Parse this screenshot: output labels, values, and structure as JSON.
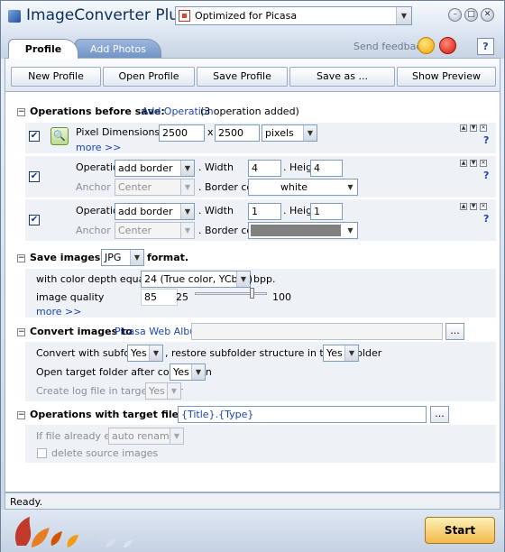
{
  "title": {
    "app": "ImageConverter Plus",
    "profile": "Optimized  for Picasa",
    "win_buttons": [
      "–",
      "□",
      "✕"
    ]
  },
  "tabs": [
    {
      "label": "Profile"
    },
    {
      "label": "Add Photos"
    }
  ],
  "feedback": {
    "label": "Send feedback:",
    "help": "?"
  },
  "toolbar": {
    "new": "New Profile",
    "open": "Open Profile",
    "save": "Save Profile",
    "save_as": "Save as ...",
    "preview": "Show Preview"
  },
  "ops": {
    "title": "Operations before save:",
    "add_link": "Add Operation",
    "count": "(3 operation added)",
    "pixel": {
      "label": "Pixel Dimensions :",
      "width": "2500",
      "x": "x",
      "height": "2500",
      "unit": "pixels",
      "more": "more >>"
    },
    "border1": {
      "op_label": "Operation",
      "op_value": "add border",
      "width_label": ". Width",
      "width": "4",
      "height_label": ". Height",
      "height": "4",
      "anchor_label": "Anchor",
      "anchor": "Center",
      "color_label": ". Border color",
      "color": "white"
    },
    "border2": {
      "op_label": "Operation",
      "op_value": "add border",
      "width_label": ". Width",
      "width": "1",
      "height_label": ". Height",
      "height": "1",
      "anchor_label": "Anchor",
      "anchor": "Center",
      "color_label": ". Border color",
      "color_hex": "#808080"
    },
    "help": "?"
  },
  "save": {
    "title_pre": "Save images in",
    "format": "JPG",
    "title_post": "format.",
    "depth_label": "with color depth equal to",
    "depth": "24 (True color, YCbCr)",
    "bpp": "bpp.",
    "quality_label": "image quality",
    "quality": "85",
    "q_min": "25",
    "q_max": "100",
    "quality_level": 0.8,
    "more": "more >>"
  },
  "convert": {
    "title": "Convert images to",
    "target": "Picasa Web Album",
    "subfolders_label": "Convert with subfolders",
    "subfolders": "Yes",
    "restore_label": ", restore subfolder structure in target folder",
    "restore": "Yes",
    "open_label": "Open target folder after conversion",
    "open": "Yes",
    "log_label": "Create log file in target folder",
    "log": "Yes",
    "browse": "..."
  },
  "naming": {
    "title": "Operations with target file name",
    "pattern": "{Title}.{Type}",
    "exists_label": "If file already exists",
    "exists": "auto rename",
    "delete_label": "delete source images",
    "browse": "..."
  },
  "status": "Ready.",
  "start": "Start",
  "colors": {
    "accent": "#1c46b8",
    "border_color_gray": "#808080",
    "start_button": "#f2b94a"
  }
}
